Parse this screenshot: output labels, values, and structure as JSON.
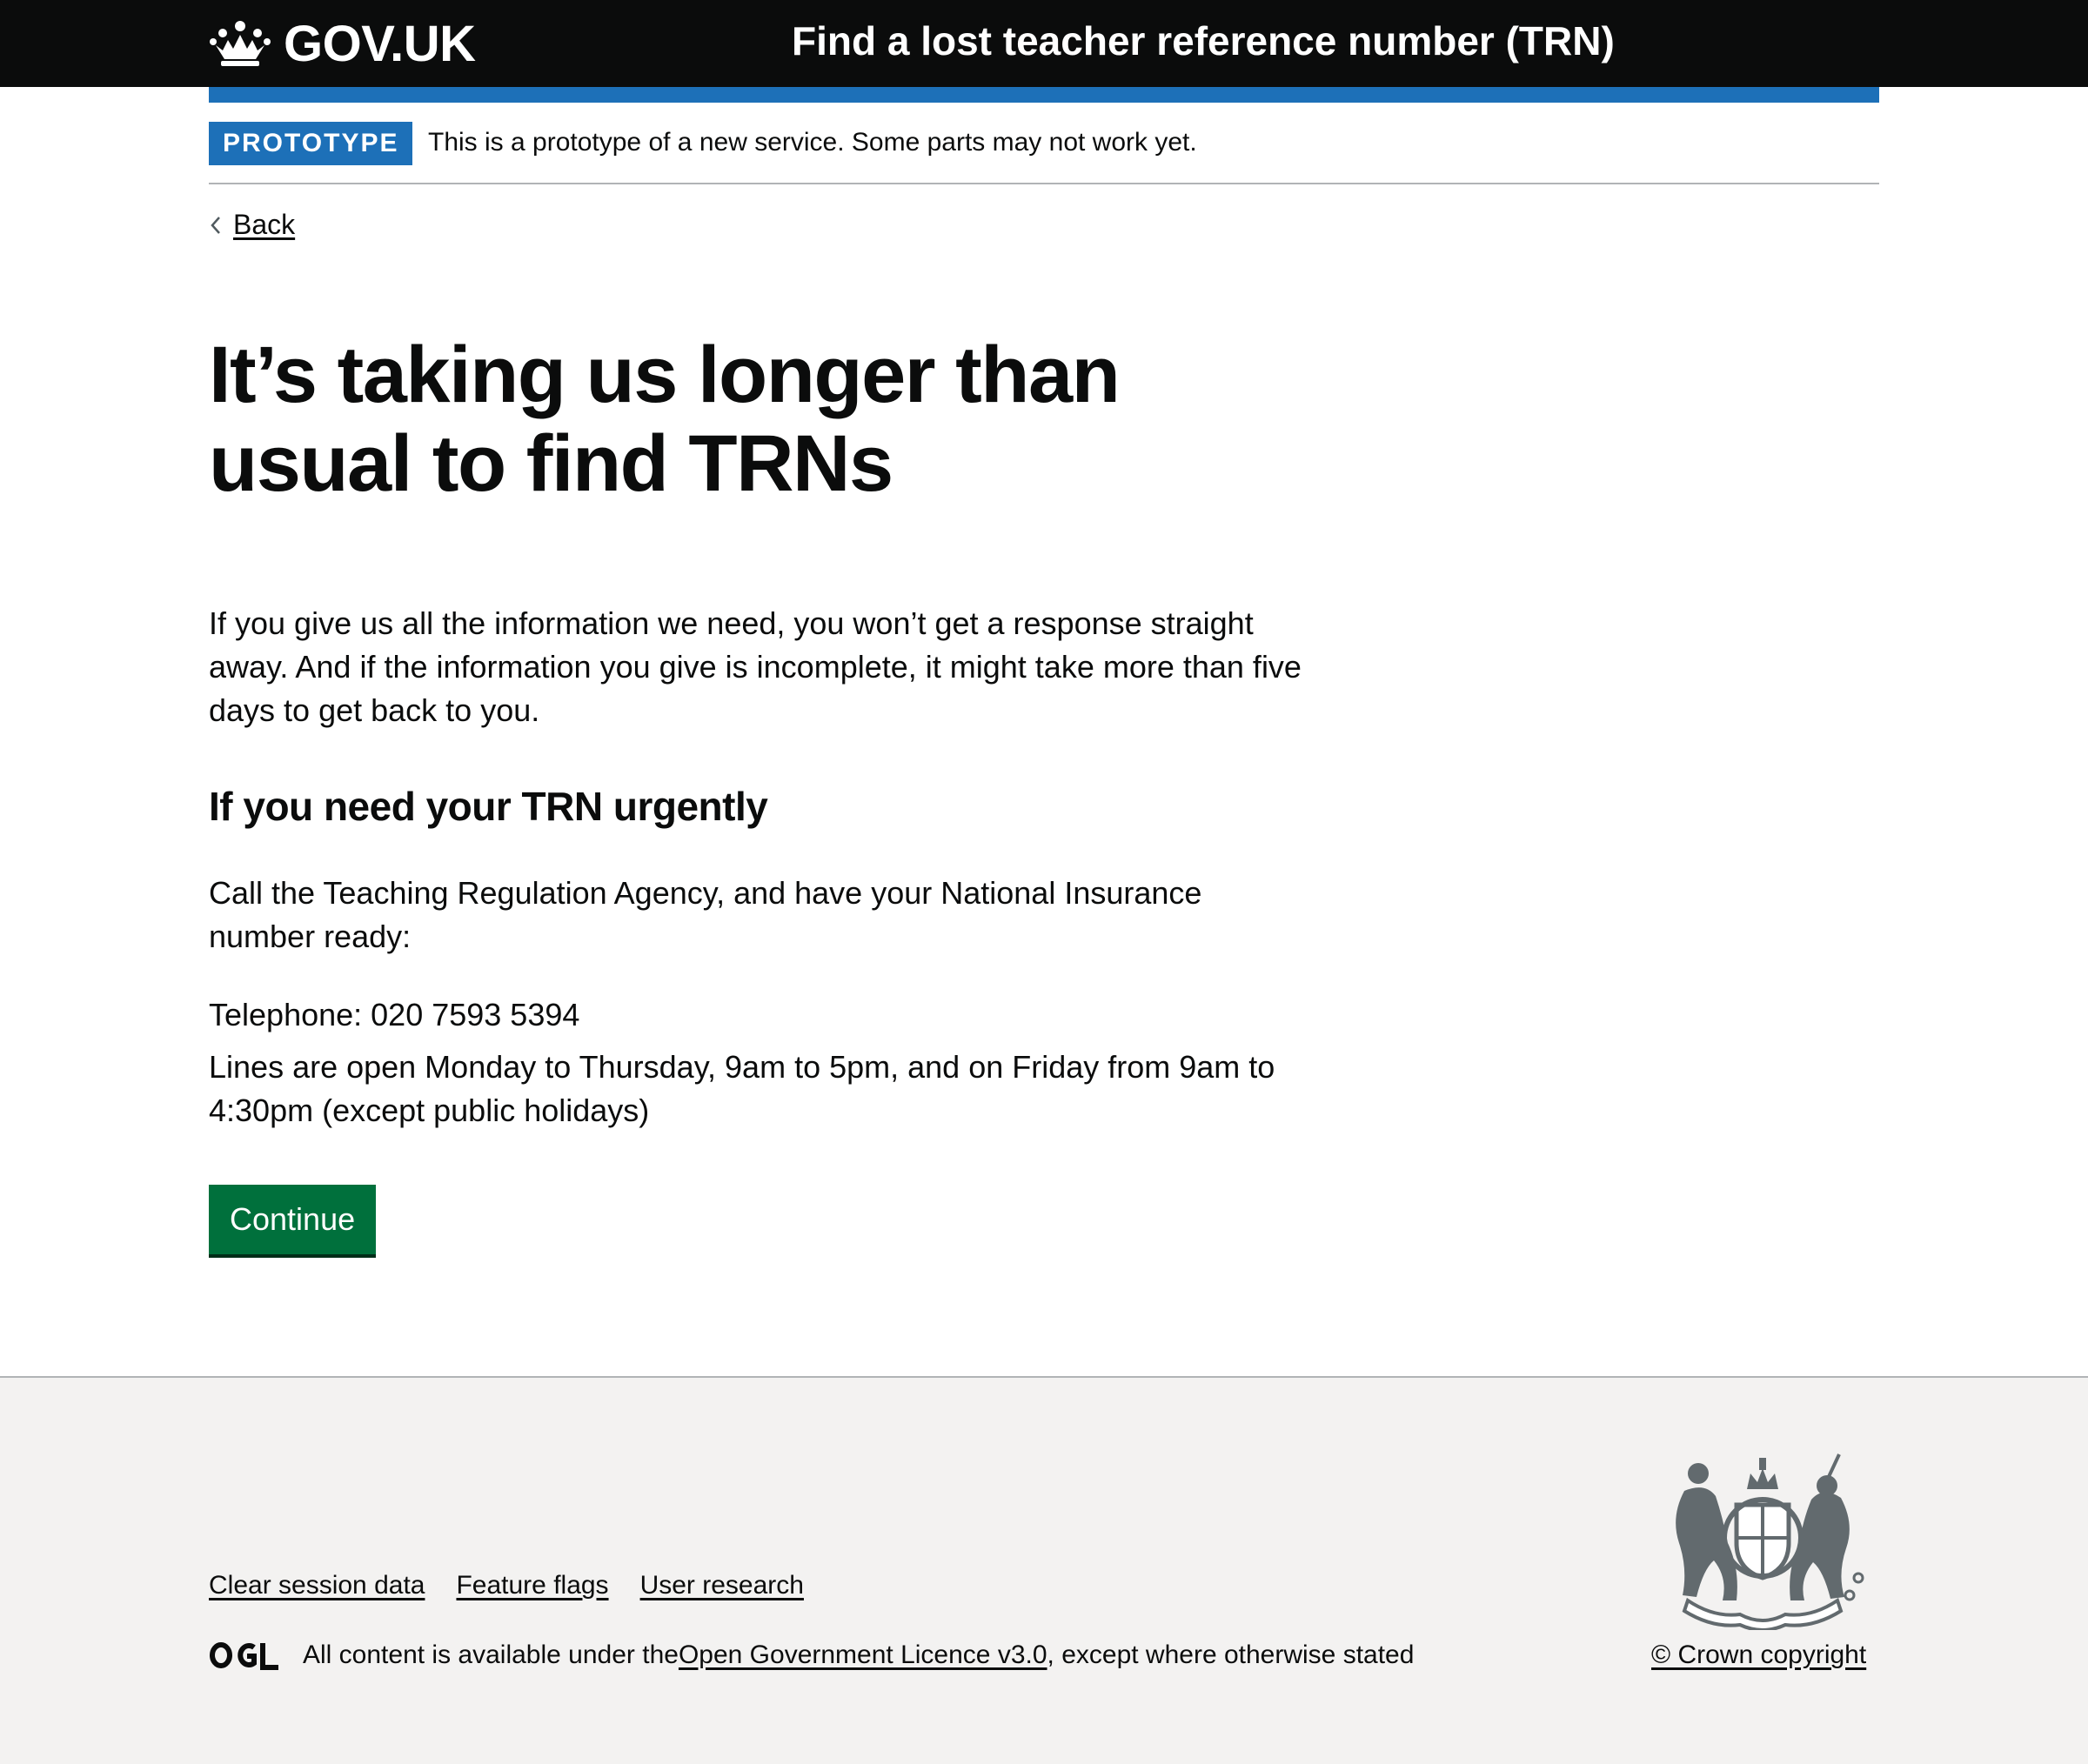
{
  "header": {
    "logo_text": "GOV.UK",
    "service_name": "Find a lost teacher reference number (TRN)",
    "logo_icon": "crown-icon"
  },
  "phase_banner": {
    "tag": "PROTOTYPE",
    "text": "This is a prototype of a new service. Some parts may not work yet."
  },
  "back_link": {
    "label": "Back",
    "icon": "chevron-left-icon"
  },
  "main": {
    "title": "It’s taking us longer than usual to find TRNs",
    "intro": "If you give us all the information we need, you won’t get a response straight away. And if the information you give is incomplete, it might take more than five days to get back to you.",
    "urgent_heading": "If you need your TRN urgently",
    "call_text": "Call the Teaching Regulation Agency, and have your National Insurance number ready:",
    "telephone": "Telephone: 020 7593 5394",
    "opening_hours": "Lines are open Monday to Thursday, 9am to 5pm, and on Friday from 9am to 4:30pm (except public holidays)",
    "continue_label": "Continue"
  },
  "footer": {
    "links": [
      "Clear session data",
      "Feature flags",
      "User research"
    ],
    "licence_prefix": "All content is available under the ",
    "licence_link": "Open Government Licence v3.0",
    "licence_suffix": ", except where otherwise stated",
    "copyright": "© Crown copyright",
    "ogl_logo": "ogl-logo-icon",
    "crest_icon": "royal-coat-of-arms-icon"
  },
  "colors": {
    "header_bg": "#0b0c0c",
    "brand_blue": "#1d70b8",
    "button_green": "#00703c",
    "footer_bg": "#f3f2f1",
    "border_grey": "#b1b4b6"
  }
}
